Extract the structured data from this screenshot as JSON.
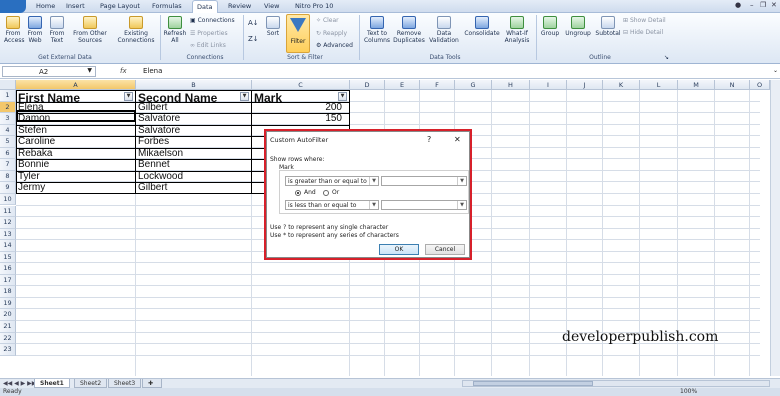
{
  "ribbon": {
    "tabs": [
      "Home",
      "Insert",
      "Page Layout",
      "Formulas",
      "Data",
      "Review",
      "View",
      "Nitro Pro 10"
    ],
    "active_tab": "Data",
    "get_external": {
      "from_access": "From Access",
      "from_web": "From Web",
      "from_text": "From Text",
      "from_other": "From Other Sources",
      "existing": "Existing Connections",
      "group": "Get External Data"
    },
    "connections": {
      "refresh": "Refresh All",
      "connections": "Connections",
      "properties": "Properties",
      "edit_links": "Edit Links",
      "group": "Connections"
    },
    "sort_filter": {
      "sort": "Sort",
      "filter": "Filter",
      "clear": "Clear",
      "reapply": "Reapply",
      "advanced": "Advanced",
      "group": "Sort & Filter"
    },
    "data_tools": {
      "text_to_columns": "Text to Columns",
      "remove_duplicates": "Remove Duplicates",
      "data_validation": "Data Validation",
      "consolidate": "Consolidate",
      "what_if": "What-If Analysis",
      "group": "Data Tools"
    },
    "outline": {
      "group_btn": "Group",
      "ungroup": "Ungroup",
      "subtotal": "Subtotal",
      "show_detail": "Show Detail",
      "hide_detail": "Hide Detail",
      "group": "Outline"
    }
  },
  "formula_bar": {
    "name_box": "A2",
    "fx": "fx",
    "value": "Elena"
  },
  "columns": [
    "A",
    "B",
    "C",
    "D",
    "E",
    "F",
    "G",
    "H",
    "I",
    "J",
    "K",
    "L",
    "M",
    "N",
    "O"
  ],
  "rows": [
    "1",
    "2",
    "3",
    "4",
    "5",
    "6",
    "7",
    "8",
    "9",
    "10",
    "11",
    "12",
    "13",
    "14",
    "15",
    "16",
    "17",
    "18",
    "19",
    "20",
    "21",
    "22",
    "23"
  ],
  "table": {
    "headers": [
      "First Name",
      "Second Name",
      "Mark"
    ],
    "rows": [
      [
        "Elena",
        "Gilbert",
        "200"
      ],
      [
        "Damon",
        "Salvatore",
        "150"
      ],
      [
        "Stefen",
        "Salvatore",
        ""
      ],
      [
        "Caroline",
        "Forbes",
        ""
      ],
      [
        "Rebaka",
        "Mikaelson",
        ""
      ],
      [
        "Bonnie",
        "Bennet",
        ""
      ],
      [
        "Tyler",
        "Lockwood",
        ""
      ],
      [
        "Jermy",
        "Gilbert",
        ""
      ]
    ]
  },
  "dialog": {
    "title": "Custom AutoFilter",
    "help": "?",
    "close": "✕",
    "show_rows": "Show rows where:",
    "field": "Mark",
    "op1": "is greater than or equal to",
    "op2": "is less than or equal to",
    "and": "And",
    "or": "Or",
    "hint1": "Use ? to represent any single character",
    "hint2": "Use * to represent any series of characters",
    "ok": "OK",
    "cancel": "Cancel"
  },
  "sheets": [
    "Sheet1",
    "Sheet2",
    "Sheet3"
  ],
  "active_sheet": "Sheet1",
  "status": "Ready",
  "zoom": "100%",
  "watermark": "developerpublish.com"
}
